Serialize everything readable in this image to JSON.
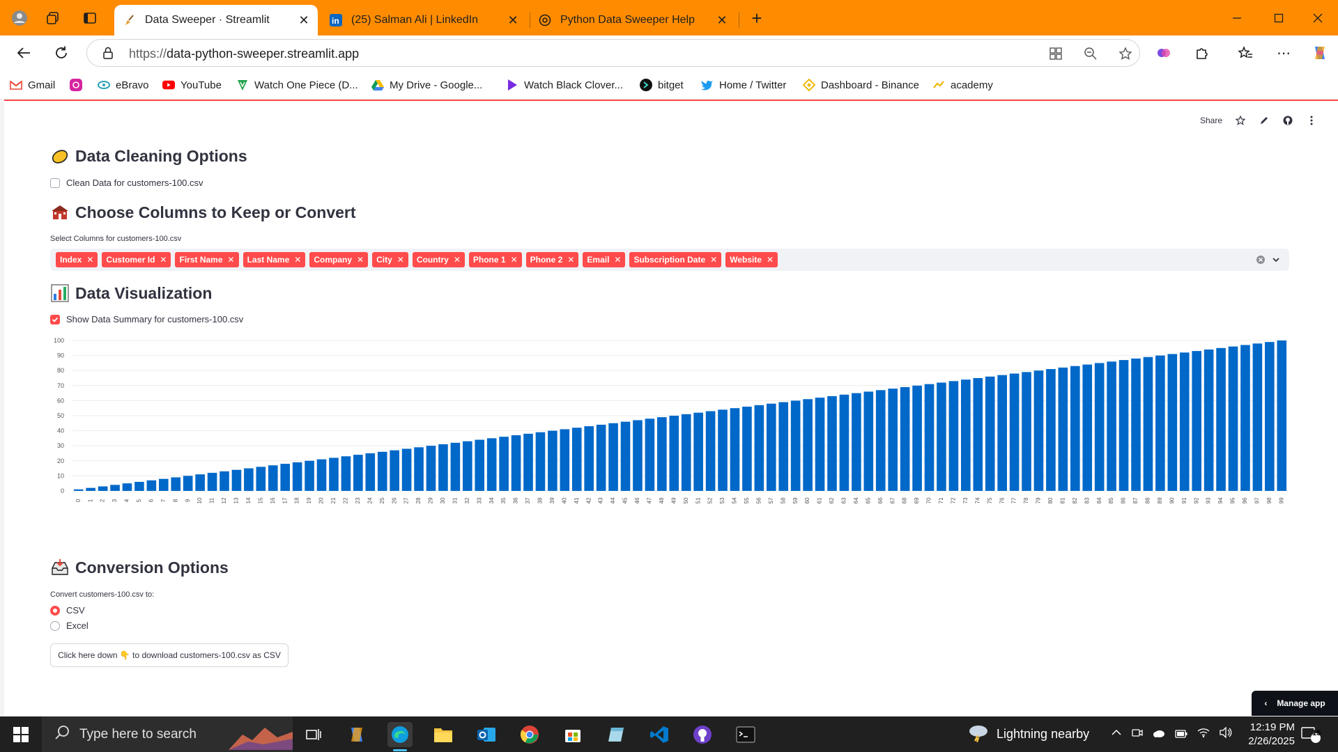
{
  "browser": {
    "tabs": [
      {
        "title": "Data Sweeper · Streamlit",
        "active": true
      },
      {
        "title": "(25) Salman Ali | LinkedIn",
        "active": false
      },
      {
        "title": "Python Data Sweeper Help",
        "active": false
      }
    ],
    "url_protocol": "https://",
    "url_host": "data-python-sweeper.streamlit.app",
    "bookmarks": [
      "Gmail",
      "",
      "eBravo",
      "YouTube",
      "Watch One Piece (D...",
      "My Drive - Google...",
      "Watch Black Clover...",
      "bitget",
      "Home / Twitter",
      "Dashboard - Binance",
      "academy"
    ]
  },
  "streamlit_toolbar": {
    "share_label": "Share"
  },
  "sections": {
    "cleaning": {
      "title": "Data Cleaning Options",
      "checkbox_label": "Clean Data for customers-100.csv",
      "checked": false
    },
    "columns": {
      "title": "Choose Columns to Keep or Convert",
      "select_label": "Select Columns for customers-100.csv",
      "chips": [
        "Index",
        "Customer Id",
        "First Name",
        "Last Name",
        "Company",
        "City",
        "Country",
        "Phone 1",
        "Phone 2",
        "Email",
        "Subscription Date",
        "Website"
      ]
    },
    "visualization": {
      "title": "Data Visualization",
      "checkbox_label": "Show Data Summary for customers-100.csv",
      "checked": true
    },
    "conversion": {
      "title": "Conversion Options",
      "radio_label": "Convert customers-100.csv to:",
      "options": [
        "CSV",
        "Excel"
      ],
      "selected": "CSV",
      "download_label": "Click here down 👇 to download customers-100.csv as CSV"
    }
  },
  "manage_app_label": "Manage app",
  "chart_data": {
    "type": "bar",
    "title": "",
    "xlabel": "",
    "ylabel": "",
    "x": [
      0,
      1,
      2,
      3,
      4,
      5,
      6,
      7,
      8,
      9,
      10,
      11,
      12,
      13,
      14,
      15,
      16,
      17,
      18,
      19,
      20,
      21,
      22,
      23,
      24,
      25,
      26,
      27,
      28,
      29,
      30,
      31,
      32,
      33,
      34,
      35,
      36,
      37,
      38,
      39,
      40,
      41,
      42,
      43,
      44,
      45,
      46,
      47,
      48,
      49,
      50,
      51,
      52,
      53,
      54,
      55,
      56,
      57,
      58,
      59,
      60,
      61,
      62,
      63,
      64,
      65,
      66,
      67,
      68,
      69,
      70,
      71,
      72,
      73,
      74,
      75,
      76,
      77,
      78,
      79,
      80,
      81,
      82,
      83,
      84,
      85,
      86,
      87,
      88,
      89,
      90,
      91,
      92,
      93,
      94,
      95,
      96,
      97,
      98,
      99
    ],
    "values": [
      1,
      2,
      3,
      4,
      5,
      6,
      7,
      8,
      9,
      10,
      11,
      12,
      13,
      14,
      15,
      16,
      17,
      18,
      19,
      20,
      21,
      22,
      23,
      24,
      25,
      26,
      27,
      28,
      29,
      30,
      31,
      32,
      33,
      34,
      35,
      36,
      37,
      38,
      39,
      40,
      41,
      42,
      43,
      44,
      45,
      46,
      47,
      48,
      49,
      50,
      51,
      52,
      53,
      54,
      55,
      56,
      57,
      58,
      59,
      60,
      61,
      62,
      63,
      64,
      65,
      66,
      67,
      68,
      69,
      70,
      71,
      72,
      73,
      74,
      75,
      76,
      77,
      78,
      79,
      80,
      81,
      82,
      83,
      84,
      85,
      86,
      87,
      88,
      89,
      90,
      91,
      92,
      93,
      94,
      95,
      96,
      97,
      98,
      99,
      100
    ],
    "yticks": [
      0,
      10,
      20,
      30,
      40,
      50,
      60,
      70,
      80,
      90,
      100
    ],
    "ylim": [
      0,
      100
    ],
    "color": "#0068c9",
    "grid": true
  },
  "taskbar": {
    "search_placeholder": "Type here to search",
    "weather": "Lightning nearby",
    "time": "12:19 PM",
    "date": "2/26/2025",
    "notification_count": "15"
  }
}
